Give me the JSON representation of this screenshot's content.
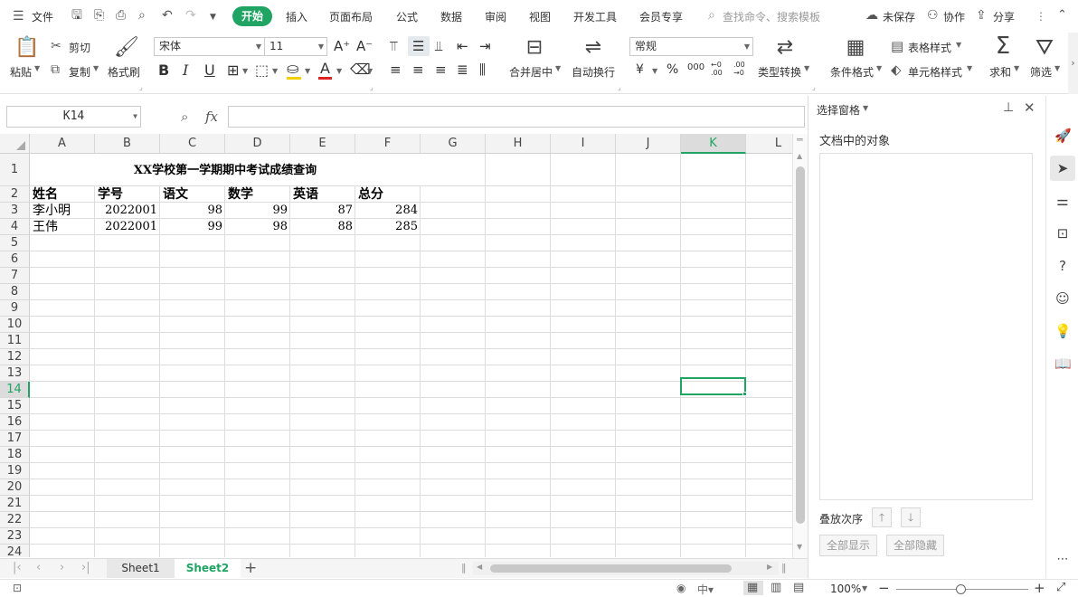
{
  "menu": {
    "file": "文件",
    "tabs": [
      "开始",
      "插入",
      "页面布局",
      "公式",
      "数据",
      "审阅",
      "视图",
      "开发工具",
      "会员专享"
    ],
    "search_placeholder": "查找命令、搜索模板",
    "unsaved": "未保存",
    "collab": "协作",
    "share": "分享"
  },
  "ribbon": {
    "paste": "粘贴",
    "cut": "剪切",
    "copy": "复制",
    "format_painter": "格式刷",
    "font_name": "宋体",
    "font_size": "11",
    "bold": "B",
    "italic": "I",
    "underline": "U",
    "merge_center": "合并居中",
    "wrap_text": "自动换行",
    "number_format": "常规",
    "type_convert": "类型转换",
    "cond_format": "条件格式",
    "table_style": "表格样式",
    "cell_style": "单元格样式",
    "sum": "求和",
    "filter": "筛选",
    "currency": "¥",
    "percent": "%",
    "thousands": "000",
    "dec_inc": "←0 .00",
    "dec_dec": ".00 →0"
  },
  "formula_bar": {
    "name_box": "K14",
    "fx": "fx",
    "formula": ""
  },
  "sheet": {
    "columns": [
      "A",
      "B",
      "C",
      "D",
      "E",
      "F",
      "G",
      "H",
      "I",
      "J",
      "K",
      "L"
    ],
    "selected_column": "K",
    "selected_row": "14",
    "rows": [
      "1",
      "2",
      "3",
      "4",
      "5",
      "6",
      "7",
      "8",
      "9",
      "10",
      "11",
      "12",
      "13",
      "14",
      "15",
      "16",
      "17",
      "18",
      "19",
      "20",
      "21",
      "22",
      "23",
      "24"
    ],
    "title": "XX学校第一学期期中考试成绩查询",
    "headers": [
      "姓名",
      "学号",
      "语文",
      "数学",
      "英语",
      "总分"
    ],
    "data": [
      [
        "李小明",
        "2022001",
        "98",
        "99",
        "87",
        "284"
      ],
      [
        "王伟",
        "2022001",
        "99",
        "98",
        "88",
        "285"
      ]
    ]
  },
  "sheets": {
    "tabs": [
      "Sheet1",
      "Sheet2"
    ],
    "active": "Sheet2",
    "add": "+"
  },
  "pane": {
    "title": "选择窗格",
    "objects_label": "文档中的对象",
    "order_label": "叠放次序",
    "show_all": "全部显示",
    "hide_all": "全部隐藏"
  },
  "status": {
    "zoom": "100%",
    "minus": "−",
    "plus": "+"
  },
  "colors": {
    "accent": "#1fa463",
    "selection": "#1fa463"
  }
}
